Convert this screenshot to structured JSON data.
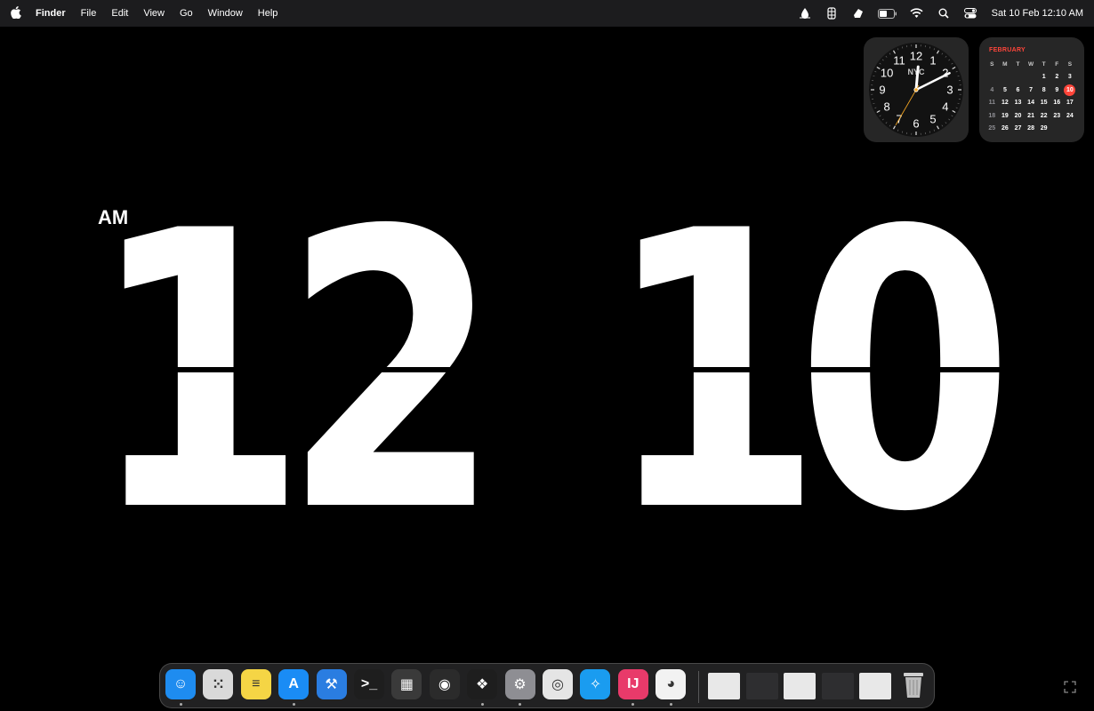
{
  "menubar": {
    "app_name": "Finder",
    "items": [
      "File",
      "Edit",
      "View",
      "Go",
      "Window",
      "Help"
    ],
    "status_icons": [
      "drop-icon",
      "figma-icon",
      "app-icon",
      "battery-icon",
      "wifi-icon",
      "search-icon",
      "control-center-icon"
    ],
    "datetime": "Sat 10 Feb  12:10 AM"
  },
  "clock_widget": {
    "city": "NYC",
    "numbers": [
      "12",
      "1",
      "2",
      "3",
      "4",
      "5",
      "6",
      "7",
      "8",
      "9",
      "10",
      "11"
    ],
    "hour": 12,
    "minute": 10,
    "second": 35
  },
  "calendar_widget": {
    "month": "FEBRUARY",
    "weekdays": [
      "S",
      "M",
      "T",
      "W",
      "T",
      "F",
      "S"
    ],
    "weeks": [
      [
        "",
        "",
        "",
        "",
        "1",
        "2",
        "3"
      ],
      [
        "4",
        "5",
        "6",
        "7",
        "8",
        "9",
        "10"
      ],
      [
        "11",
        "12",
        "13",
        "14",
        "15",
        "16",
        "17"
      ],
      [
        "18",
        "19",
        "20",
        "21",
        "22",
        "23",
        "24"
      ],
      [
        "25",
        "26",
        "27",
        "28",
        "29",
        "",
        ""
      ]
    ],
    "today": "10"
  },
  "flip_clock": {
    "ampm": "AM",
    "digits": [
      "1",
      "2",
      "1",
      "0"
    ]
  },
  "dock": {
    "apps": [
      {
        "name": "finder-icon",
        "color": "#1e8cf0",
        "running": true
      },
      {
        "name": "launchpad-icon",
        "color": "#d9d9d9",
        "running": false
      },
      {
        "name": "notes-icon",
        "color": "#f5d545",
        "running": false
      },
      {
        "name": "app-store-icon",
        "color": "#1a8cf5",
        "running": true
      },
      {
        "name": "xcode-icon",
        "color": "#2a7de1",
        "running": false
      },
      {
        "name": "terminal-icon",
        "color": "#1e1e1e",
        "running": false
      },
      {
        "name": "final-cut-icon",
        "color": "#3a3a3a",
        "running": false
      },
      {
        "name": "blender-icon",
        "color": "#2b2b2b",
        "running": false
      },
      {
        "name": "figma-icon",
        "color": "#1e1e1e",
        "running": true
      },
      {
        "name": "system-settings-icon",
        "color": "#8e8e93",
        "running": true
      },
      {
        "name": "motion-icon",
        "color": "#e5e5e5",
        "running": false
      },
      {
        "name": "safari-icon",
        "color": "#1a9cf0",
        "running": false
      },
      {
        "name": "intellij-icon",
        "color": "#e83a6a",
        "running": true
      },
      {
        "name": "chrome-icon",
        "color": "#f2f2f2",
        "running": true
      }
    ],
    "window_thumbnails": [
      "thumb-1",
      "thumb-2",
      "thumb-3",
      "thumb-4",
      "thumb-5"
    ],
    "trash": "trash-icon"
  }
}
